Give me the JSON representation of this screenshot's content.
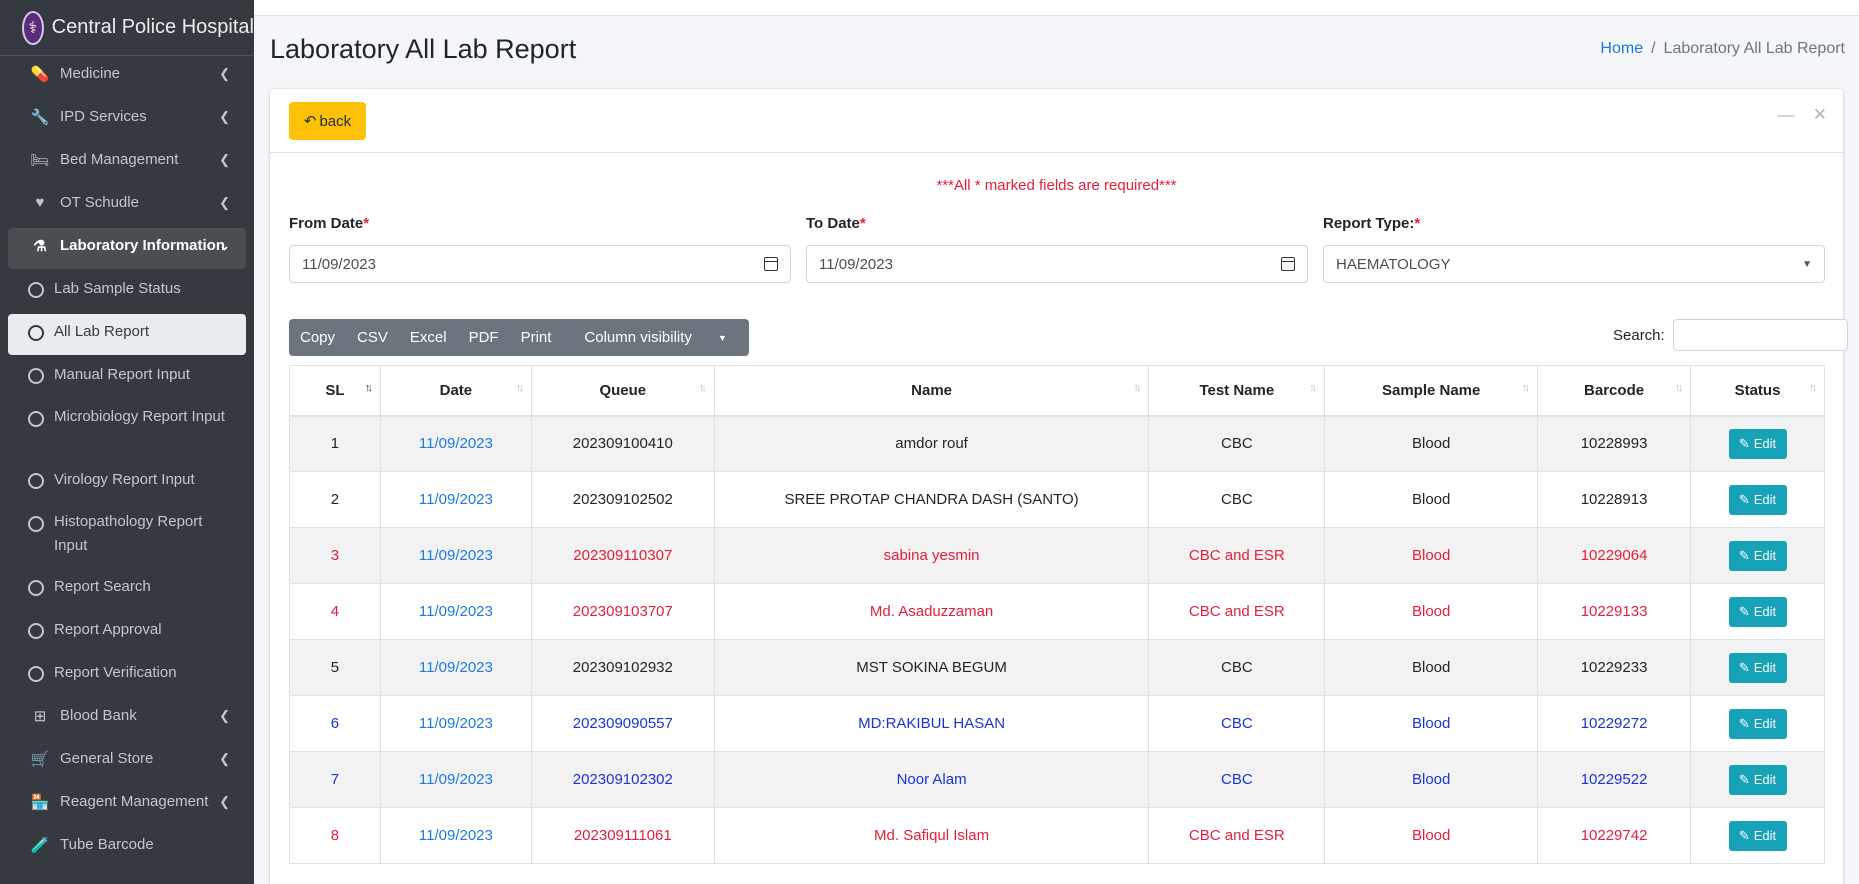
{
  "sidebar": {
    "brand": "Central Police Hospital",
    "items": [
      {
        "label": "Medicine",
        "icon": "capsules-icon"
      },
      {
        "label": "IPD Services",
        "icon": "wrench-icon"
      },
      {
        "label": "Bed Management",
        "icon": "bed-icon"
      },
      {
        "label": "OT Schudle",
        "icon": "heartbeat-icon"
      },
      {
        "label": "Laboratory Information",
        "icon": "flask-icon"
      },
      {
        "label": "Lab Sample Status"
      },
      {
        "label": "All Lab Report"
      },
      {
        "label": "Manual Report Input"
      },
      {
        "label": "Microbiology Report Input"
      },
      {
        "label": "Virology Report Input"
      },
      {
        "label": "Histopathology Report Input"
      },
      {
        "label": "Report Search"
      },
      {
        "label": "Report Approval"
      },
      {
        "label": "Report Verification"
      },
      {
        "label": "Blood Bank",
        "icon": "plus-square-icon"
      },
      {
        "label": "General Store",
        "icon": "cart-icon"
      },
      {
        "label": "Reagent Management",
        "icon": "store-icon"
      },
      {
        "label": "Tube Barcode",
        "icon": "vials-icon"
      }
    ]
  },
  "header": {
    "title": "Laboratory All Lab Report",
    "breadcrumb_home": "Home",
    "breadcrumb_current": "Laboratory All Lab Report"
  },
  "card": {
    "back_label": "back",
    "required_note": "***All * marked fields are required***"
  },
  "form": {
    "from_date_label": "From Date",
    "from_date_value": "11/09/2023",
    "to_date_label": "To Date",
    "to_date_value": "11/09/2023",
    "report_type_label": "Report Type:",
    "report_type_value": "HAEMATOLOGY"
  },
  "toolbar": {
    "buttons": [
      "Copy",
      "CSV",
      "Excel",
      "PDF",
      "Print",
      "Column visibility"
    ],
    "search_label": "Search:"
  },
  "table": {
    "columns": [
      "SL",
      "Date",
      "Queue",
      "Name",
      "Test Name",
      "Sample Name",
      "Barcode",
      "Status"
    ],
    "edit_label": "Edit",
    "rows": [
      {
        "sl": "1",
        "date": "11/09/2023",
        "queue": "202309100410",
        "name": "amdor rouf",
        "test": "CBC",
        "sample": "Blood",
        "barcode": "10228993",
        "color": "normal"
      },
      {
        "sl": "2",
        "date": "11/09/2023",
        "queue": "202309102502",
        "name": "SREE PROTAP CHANDRA DASH (SANTO)",
        "test": "CBC",
        "sample": "Blood",
        "barcode": "10228913",
        "color": "normal"
      },
      {
        "sl": "3",
        "date": "11/09/2023",
        "queue": "202309110307",
        "name": "sabina yesmin",
        "test": "CBC and ESR",
        "sample": "Blood",
        "barcode": "10229064",
        "color": "red"
      },
      {
        "sl": "4",
        "date": "11/09/2023",
        "queue": "202309103707",
        "name": "Md. Asaduzzaman",
        "test": "CBC and ESR",
        "sample": "Blood",
        "barcode": "10229133",
        "color": "red"
      },
      {
        "sl": "5",
        "date": "11/09/2023",
        "queue": "202309102932",
        "name": "MST SOKINA BEGUM",
        "test": "CBC",
        "sample": "Blood",
        "barcode": "10229233",
        "color": "normal"
      },
      {
        "sl": "6",
        "date": "11/09/2023",
        "queue": "202309090557",
        "name": "MD:RAKIBUL HASAN",
        "test": "CBC",
        "sample": "Blood",
        "barcode": "10229272",
        "color": "blue"
      },
      {
        "sl": "7",
        "date": "11/09/2023",
        "queue": "202309102302",
        "name": "Noor Alam",
        "test": "CBC",
        "sample": "Blood",
        "barcode": "10229522",
        "color": "blue"
      },
      {
        "sl": "8",
        "date": "11/09/2023",
        "queue": "202309111061",
        "name": "Md. Safiqul Islam",
        "test": "CBC and ESR",
        "sample": "Blood",
        "barcode": "10229742",
        "color": "red"
      }
    ]
  }
}
